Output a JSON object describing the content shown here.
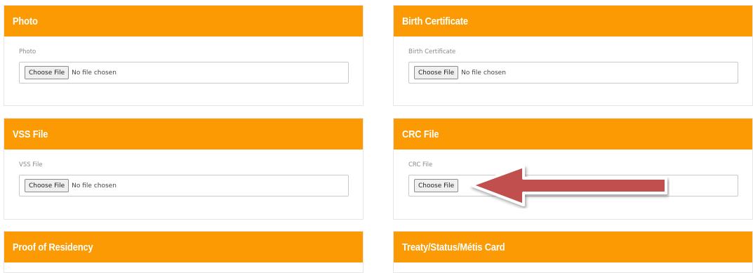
{
  "cards": [
    {
      "title": "Photo",
      "label": "Photo",
      "button": "Choose File",
      "status": "No file chosen"
    },
    {
      "title": "Birth Certificate",
      "label": "Birth Certificate",
      "button": "Choose File",
      "status": "No file chosen"
    },
    {
      "title": "VSS File",
      "label": "VSS File",
      "button": "Choose File",
      "status": "No file chosen"
    },
    {
      "title": "CRC File",
      "label": "CRC File",
      "button": "Choose File",
      "status": ""
    },
    {
      "title": "Proof of Residency"
    },
    {
      "title": "Treaty/Status/Métis Card"
    }
  ],
  "colors": {
    "header": "#fb9a02",
    "arrow_fill": "#c0504d",
    "arrow_outline": "#ffffff"
  },
  "icons": [
    "red-arrow-annotation"
  ]
}
